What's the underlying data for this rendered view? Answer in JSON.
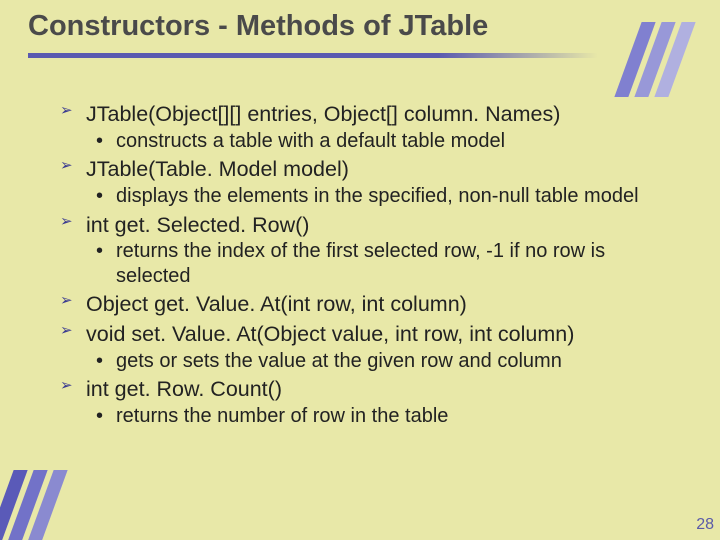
{
  "title": "Constructors - Methods of JTable",
  "bullets": [
    {
      "level": 1,
      "text": "JTable(Object[][] entries, Object[] column. Names)"
    },
    {
      "level": 2,
      "text": "constructs a table with a default table model"
    },
    {
      "level": 1,
      "text": "JTable(Table. Model model)"
    },
    {
      "level": 2,
      "text": "displays the elements in the specified, non-null table model"
    },
    {
      "level": 1,
      "text": "int get. Selected. Row()"
    },
    {
      "level": 2,
      "text": "returns the index of the first selected row, -1 if no row is selected"
    },
    {
      "level": 1,
      "text": "Object get. Value. At(int row, int column)"
    },
    {
      "level": 1,
      "text": "void set. Value. At(Object value, int row, int column)"
    },
    {
      "level": 2,
      "text": "gets or sets the value at the given row and column"
    },
    {
      "level": 1,
      "text": "int get. Row. Count()"
    },
    {
      "level": 2,
      "text": "returns the number of row in the table"
    }
  ],
  "page_number": "28"
}
